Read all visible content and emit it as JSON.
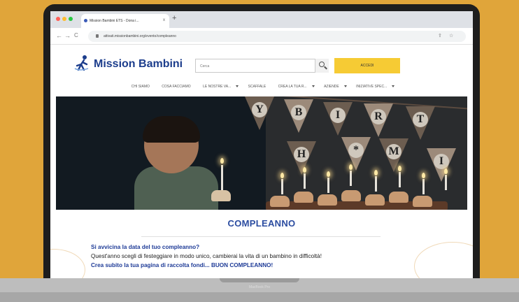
{
  "browser": {
    "tab_title": "Mission Bambini ETS - Dona i...",
    "tab_close": "x",
    "new_tab": "+",
    "url": "attivati.missionbambini.org/evento/compleanno",
    "back": "←",
    "forward": "→",
    "reload": "C"
  },
  "header": {
    "logo_text": "Mission Bambini",
    "search_placeholder": "Cerca",
    "login_label": "ACCEDI"
  },
  "menu": {
    "items": [
      {
        "label": "CHI SIAMO",
        "dropdown": false
      },
      {
        "label": "COSA FACCIAMO",
        "dropdown": false
      },
      {
        "label": "LE NOSTRE VA...",
        "dropdown": true
      },
      {
        "label": "SCAFFALE",
        "dropdown": false
      },
      {
        "label": "CREA LA TUA R...",
        "dropdown": true
      },
      {
        "label": "AZIENDE",
        "dropdown": true
      },
      {
        "label": "INIZIATIVE SPEC...",
        "dropdown": true
      }
    ]
  },
  "hero": {
    "banner_letters": [
      "Y",
      "B",
      "I",
      "R",
      "T",
      "H",
      "*",
      "M",
      "I"
    ]
  },
  "content": {
    "title": "COMPLEANNO",
    "line1": "Si avvicina la data del tuo compleanno?",
    "line2": "Quest'anno scegli di festeggiare in modo unico, cambierai la vita di un bambino in difficoltà!",
    "line3": "Crea subito la tua pagina di raccolta fondi... BUON COMPLEANNO!"
  },
  "device": {
    "label": "MacBook Pro"
  },
  "colors": {
    "background": "#E0A53A",
    "brand_blue": "#2b4ca0",
    "accent_yellow": "#F6CB34"
  }
}
